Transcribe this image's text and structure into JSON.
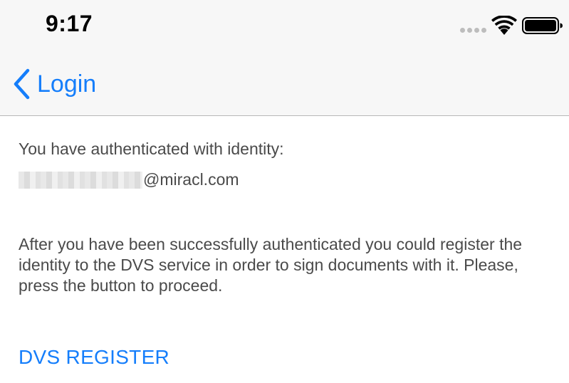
{
  "status_bar": {
    "time": "9:17",
    "icons": [
      "signal-dots-icon",
      "wifi-icon",
      "battery-icon"
    ]
  },
  "nav": {
    "back_label": "Login",
    "back_icon": "chevron-left-icon"
  },
  "content": {
    "auth_heading": "You have authenticated with identity:",
    "identity_domain": "@miracl.com",
    "description": "After you have been successfully authenticated you could register the identity to the DVS service in order to sign documents with it. Please, press the button to proceed.",
    "register_button_label": "DVS REGISTER"
  },
  "colors": {
    "accent": "#157efb",
    "bar_background": "#f7f7f7",
    "text": "#4a4a4a",
    "separator": "#b7b7b7"
  }
}
